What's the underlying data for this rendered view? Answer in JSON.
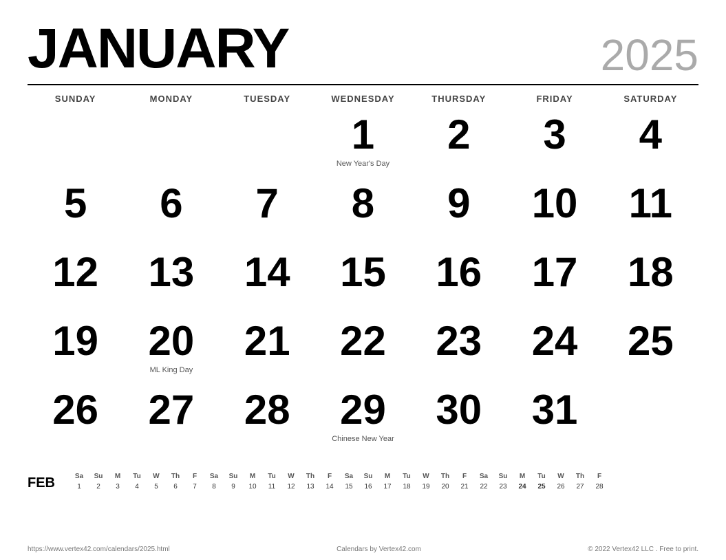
{
  "header": {
    "month": "JANUARY",
    "year": "2025"
  },
  "dayHeaders": [
    "SUNDAY",
    "MONDAY",
    "TUESDAY",
    "WEDNESDAY",
    "THURSDAY",
    "FRIDAY",
    "SATURDAY"
  ],
  "weeks": [
    [
      {
        "day": "",
        "holiday": ""
      },
      {
        "day": "",
        "holiday": ""
      },
      {
        "day": "",
        "holiday": ""
      },
      {
        "day": "1",
        "holiday": "New Year's Day"
      },
      {
        "day": "2",
        "holiday": ""
      },
      {
        "day": "3",
        "holiday": ""
      },
      {
        "day": "4",
        "holiday": ""
      }
    ],
    [
      {
        "day": "5",
        "holiday": ""
      },
      {
        "day": "6",
        "holiday": ""
      },
      {
        "day": "7",
        "holiday": ""
      },
      {
        "day": "8",
        "holiday": ""
      },
      {
        "day": "9",
        "holiday": ""
      },
      {
        "day": "10",
        "holiday": ""
      },
      {
        "day": "11",
        "holiday": ""
      }
    ],
    [
      {
        "day": "12",
        "holiday": ""
      },
      {
        "day": "13",
        "holiday": ""
      },
      {
        "day": "14",
        "holiday": ""
      },
      {
        "day": "15",
        "holiday": ""
      },
      {
        "day": "16",
        "holiday": ""
      },
      {
        "day": "17",
        "holiday": ""
      },
      {
        "day": "18",
        "holiday": ""
      }
    ],
    [
      {
        "day": "19",
        "holiday": ""
      },
      {
        "day": "20",
        "holiday": "ML King Day"
      },
      {
        "day": "21",
        "holiday": ""
      },
      {
        "day": "22",
        "holiday": ""
      },
      {
        "day": "23",
        "holiday": ""
      },
      {
        "day": "24",
        "holiday": ""
      },
      {
        "day": "25",
        "holiday": ""
      }
    ],
    [
      {
        "day": "26",
        "holiday": ""
      },
      {
        "day": "27",
        "holiday": ""
      },
      {
        "day": "28",
        "holiday": ""
      },
      {
        "day": "29",
        "holiday": "Chinese New Year"
      },
      {
        "day": "30",
        "holiday": ""
      },
      {
        "day": "31",
        "holiday": ""
      },
      {
        "day": "",
        "holiday": ""
      }
    ]
  ],
  "miniCalendar": {
    "label": "FEB",
    "headers": [
      "Sa",
      "Su",
      "M",
      "Tu",
      "W",
      "Th",
      "F",
      "Sa",
      "Su",
      "M",
      "Tu",
      "W",
      "Th",
      "F",
      "Sa",
      "Su",
      "M",
      "Tu",
      "W",
      "Th",
      "F",
      "Sa",
      "Su",
      "M",
      "Tu",
      "W",
      "Th",
      "F"
    ],
    "days": [
      "1",
      "2",
      "3",
      "4",
      "5",
      "6",
      "7",
      "8",
      "9",
      "10",
      "11",
      "12",
      "13",
      "14",
      "15",
      "16",
      "17",
      "18",
      "19",
      "20",
      "21",
      "22",
      "23",
      "24",
      "25",
      "26",
      "27",
      "28"
    ],
    "boldDays": [
      "24",
      "25"
    ]
  },
  "footer": {
    "left": "https://www.vertex42.com/calendars/2025.html",
    "center": "Calendars by Vertex42.com",
    "right": "© 2022 Vertex42 LLC . Free to print."
  }
}
